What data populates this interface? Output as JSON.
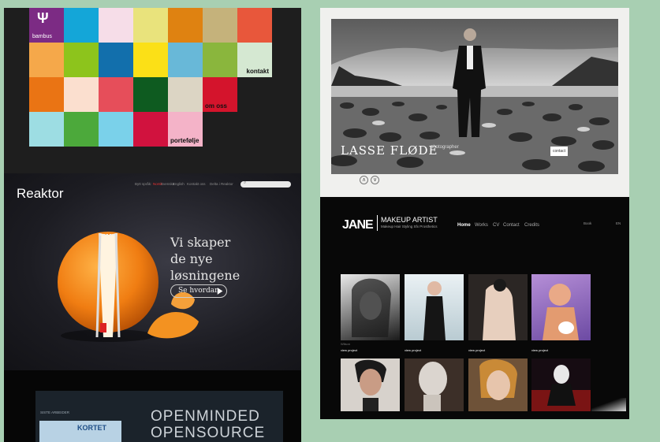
{
  "bambus": {
    "logo_label": "bambus",
    "tiles": {
      "kontakt": "kontakt",
      "om_oss": "om oss",
      "portefolje": "portefølje"
    }
  },
  "lasse": {
    "name": "LASSE FLØDE",
    "tagline": "photographer",
    "button": "contact",
    "nav_prev": "∧",
    "nav_next": "∨"
  },
  "reaktor": {
    "logo": "Reaktor",
    "nav": [
      "Bytt språk:",
      "Norsk",
      "Svenska",
      "English",
      "Kontakt oss",
      "Delta i Reaktor"
    ],
    "headline": [
      "Vi skaper",
      "de nye",
      "løsningene"
    ],
    "button": "Se hvordan"
  },
  "jane": {
    "logo": "JANE",
    "title": "MAKEUP ARTIST",
    "subtitle": "Makeup Hair Styling Sfx Prosthetics",
    "nav": [
      "Home",
      "Works",
      "CV",
      "Contact",
      "Credits"
    ],
    "misc": [
      "Book",
      "EN"
    ],
    "thumb_link": "view project"
  },
  "openminded": {
    "line1": "OPENMINDED",
    "line2": "OPENSOURCE",
    "section": "SISTE ARBEIDER",
    "kortet": "KORTET"
  },
  "colors": {
    "background": "#a8cfb2",
    "bambus_bg": "#1e1e1e",
    "reaktor_bg": "#1c1c22",
    "jane_bg": "#080808"
  }
}
